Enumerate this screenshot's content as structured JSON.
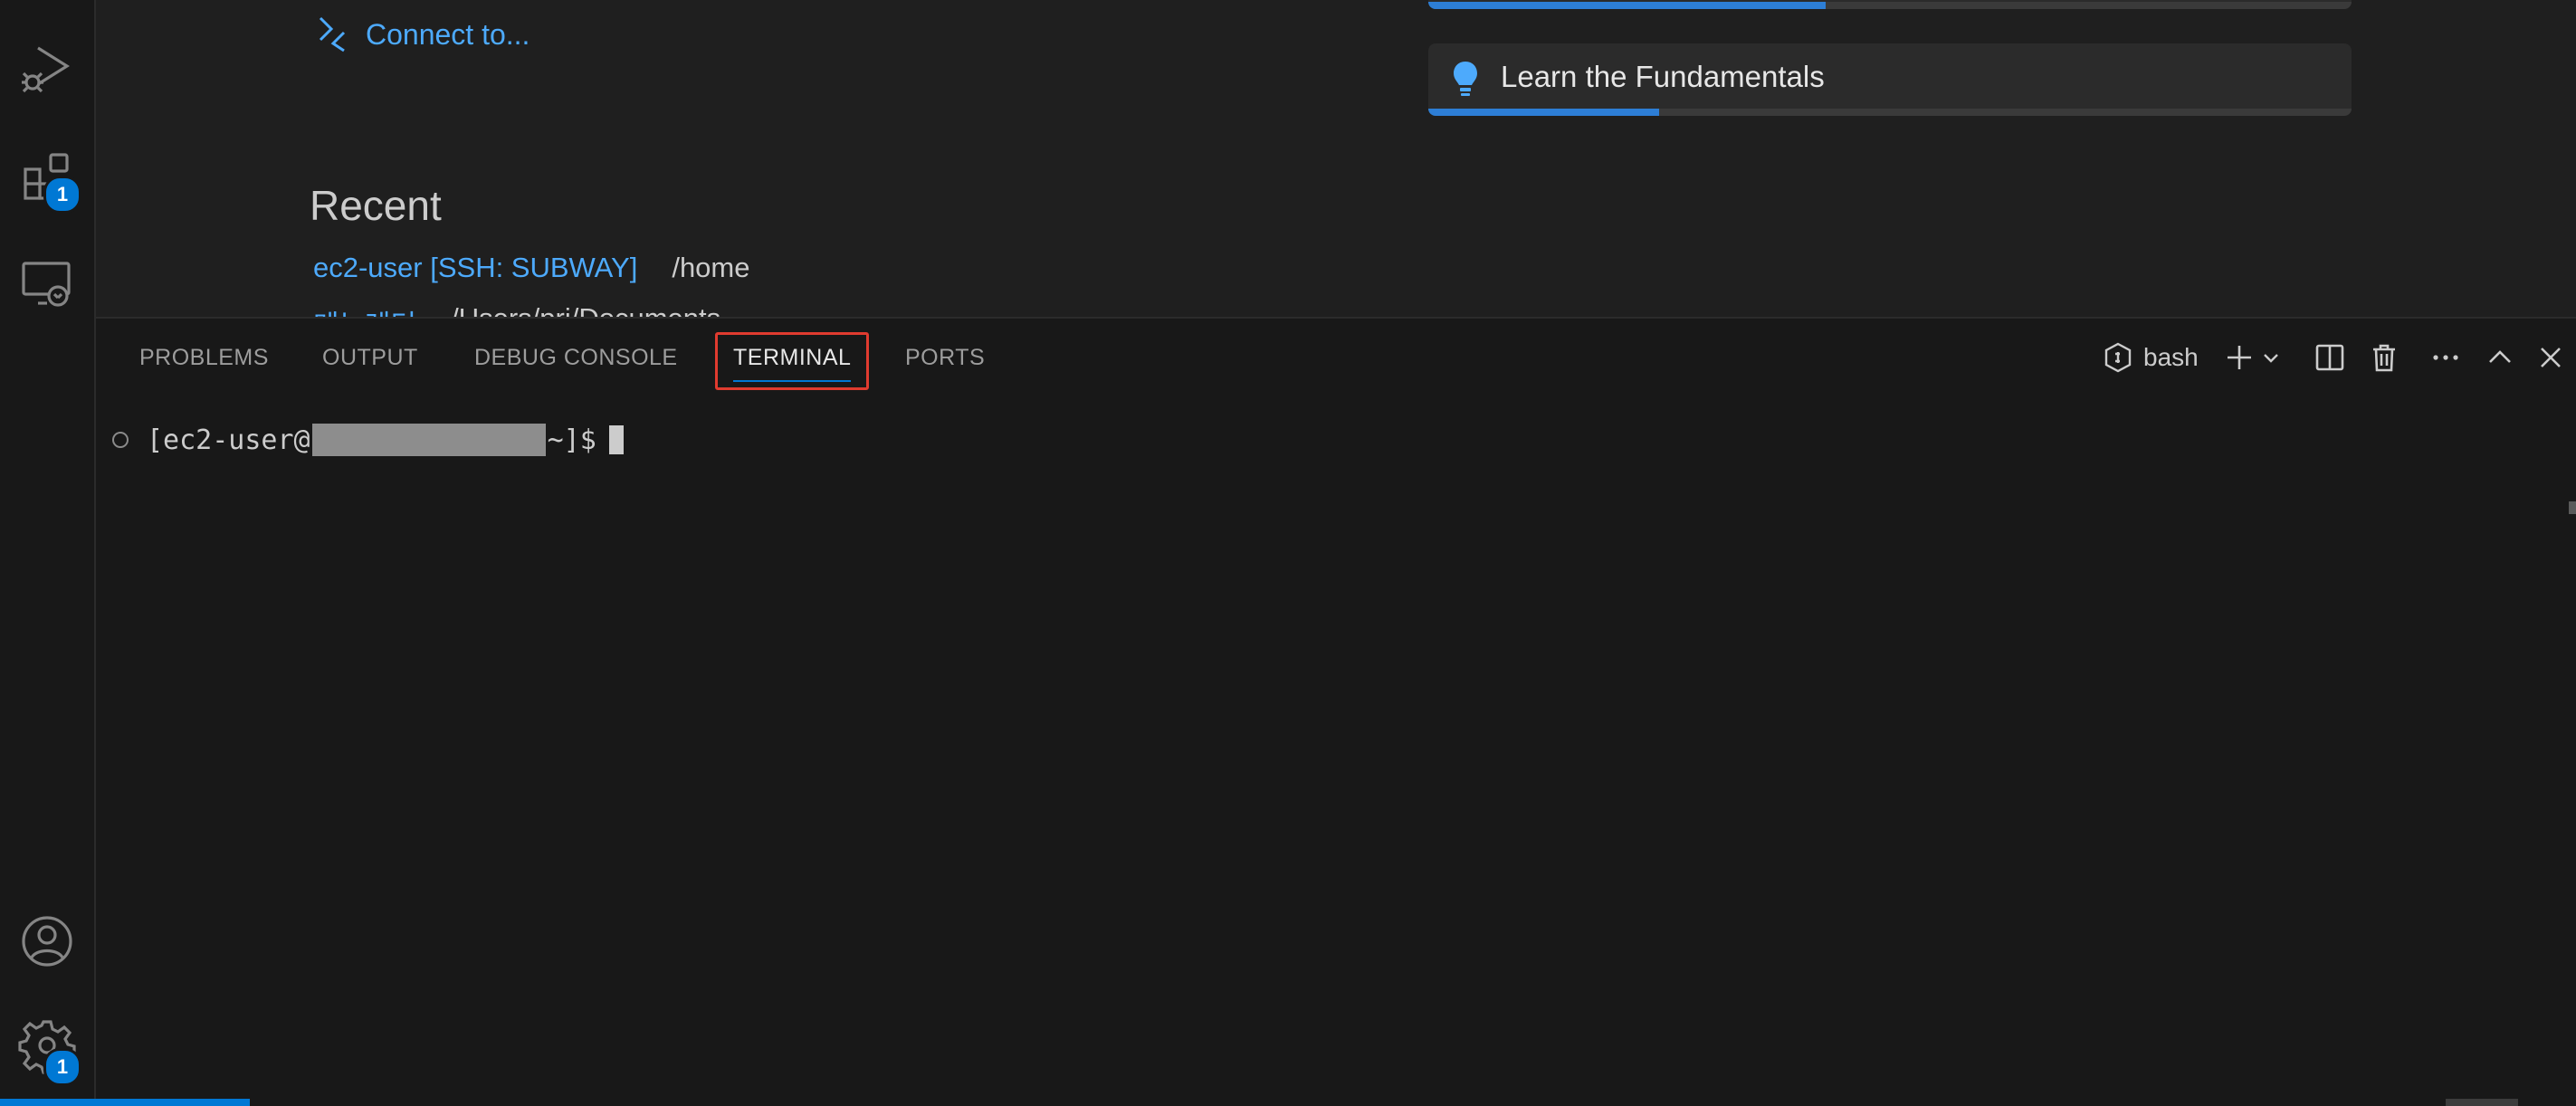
{
  "welcome": {
    "connect_label": "Connect to...",
    "recent_title": "Recent",
    "recent_items": [
      {
        "name": "ec2-user [SSH: SUBWAY]",
        "path": "/home"
      },
      {
        "name": "메뉴레더",
        "path": "/Users/pri/Documents"
      }
    ],
    "walkthrough": {
      "title": "Learn the Fundamentals",
      "progress_percent": 25,
      "top_card_progress_percent": 43
    }
  },
  "activity_bar": {
    "items": [
      {
        "icon": "run-debug-icon"
      },
      {
        "icon": "extensions-icon",
        "badge": "1"
      },
      {
        "icon": "remote-explorer-icon"
      }
    ],
    "bottom": [
      {
        "icon": "account-icon"
      },
      {
        "icon": "gear-icon",
        "badge": "1"
      }
    ]
  },
  "panel": {
    "tabs": [
      {
        "label": "PROBLEMS"
      },
      {
        "label": "OUTPUT"
      },
      {
        "label": "DEBUG CONSOLE"
      },
      {
        "label": "TERMINAL",
        "active": true
      },
      {
        "label": "PORTS"
      }
    ],
    "shell_label": "bash",
    "terminal": {
      "prompt_prefix": "[ec2-user@",
      "prompt_host_redacted": true,
      "prompt_suffix": "~]$"
    }
  },
  "colors": {
    "accent": "#0078d4",
    "link": "#4daafc",
    "highlight_box": "#e03b2f"
  }
}
